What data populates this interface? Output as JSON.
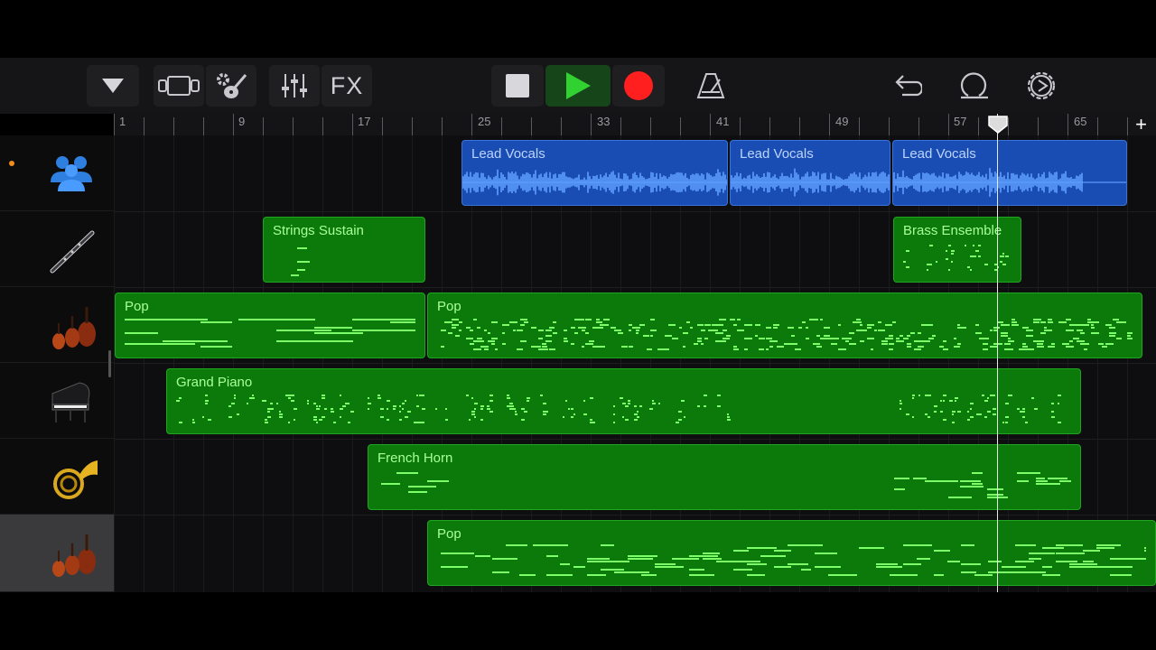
{
  "toolbar": {
    "fx_label": "FX"
  },
  "ruler": {
    "marks": [
      "1",
      "9",
      "17",
      "25",
      "33",
      "41",
      "49",
      "57",
      "65"
    ],
    "add_label": "+"
  },
  "tracks": [
    {
      "instrument_icon": "singers-icon",
      "recording_enabled": true
    },
    {
      "instrument_icon": "clarinet-icon"
    },
    {
      "instrument_icon": "strings-icon"
    },
    {
      "instrument_icon": "grand-piano-icon"
    },
    {
      "instrument_icon": "french-horn-icon"
    },
    {
      "instrument_icon": "strings-icon",
      "selected": true
    }
  ],
  "regions": {
    "lead_vocals_1": "Lead Vocals",
    "lead_vocals_2": "Lead Vocals",
    "lead_vocals_3": "Lead Vocals",
    "strings_sustain": "Strings Sustain",
    "brass_ensemble": "Brass Ensemble",
    "pop_1": "Pop",
    "pop_2": "Pop",
    "grand_piano": "Grand Piano",
    "french_horn": "French Horn",
    "pop_3": "Pop"
  },
  "colors": {
    "audio_region": "#1a4db3",
    "midi_region": "#0b7a0b",
    "midi_notes": "#7dff6a",
    "waveform": "#5ea0ff",
    "play": "#32d132",
    "record": "#ff1f1f"
  }
}
